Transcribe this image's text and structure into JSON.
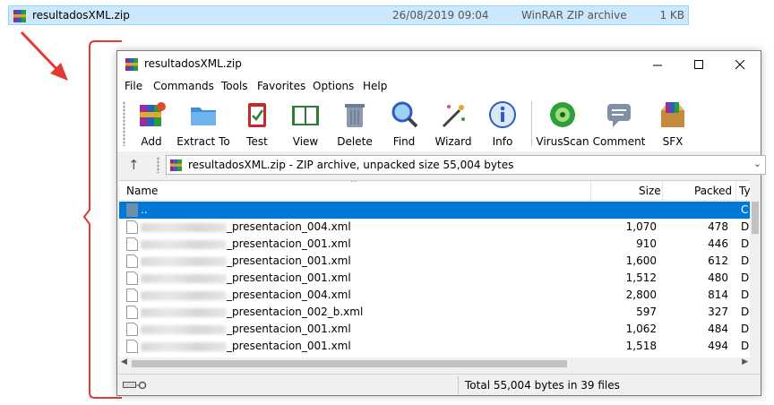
{
  "explorer": {
    "file_name": "resultadosXML.zip",
    "date": "26/08/2019 09:04",
    "type": "WinRAR ZIP archive",
    "size": "1 KB"
  },
  "annotation": {
    "color": "#e53935"
  },
  "window": {
    "title": "resultadosXML.zip",
    "menu": [
      "File",
      "Commands",
      "Tools",
      "Favorites",
      "Options",
      "Help"
    ],
    "toolbar": [
      {
        "label": "Add",
        "icon": "add-books-icon"
      },
      {
        "label": "Extract To",
        "icon": "extract-folder-icon"
      },
      {
        "label": "Test",
        "icon": "test-clipboard-icon"
      },
      {
        "label": "View",
        "icon": "view-book-icon"
      },
      {
        "label": "Delete",
        "icon": "trash-icon"
      },
      {
        "label": "Find",
        "icon": "magnifier-icon"
      },
      {
        "label": "Wizard",
        "icon": "wand-icon"
      },
      {
        "label": "Info",
        "icon": "info-icon"
      },
      {
        "label": "VirusScan",
        "icon": "virus-scan-icon"
      },
      {
        "label": "Comment",
        "icon": "comment-icon"
      },
      {
        "label": "SFX",
        "icon": "sfx-box-icon"
      }
    ],
    "address": "resultadosXML.zip - ZIP archive, unpacked size 55,004 bytes",
    "columns": {
      "name": "Name",
      "size": "Size",
      "packed": "Packed",
      "type": "Ty"
    },
    "parent_row": {
      "name": "..",
      "type": "C"
    },
    "files": [
      {
        "name": "_presentacion_004.xml",
        "size": "1,070",
        "packed": "478",
        "type": "D"
      },
      {
        "name": "_presentacion_001.xml",
        "size": "910",
        "packed": "446",
        "type": "D"
      },
      {
        "name": "_presentacion_001.xml",
        "size": "1,600",
        "packed": "612",
        "type": "D"
      },
      {
        "name": "_presentacion_001.xml",
        "size": "1,512",
        "packed": "480",
        "type": "D"
      },
      {
        "name": "_presentacion_004.xml",
        "size": "2,800",
        "packed": "814",
        "type": "D"
      },
      {
        "name": "_presentacion_002_b.xml",
        "size": "597",
        "packed": "327",
        "type": "D"
      },
      {
        "name": "_presentacion_001.xml",
        "size": "1,062",
        "packed": "484",
        "type": "D"
      },
      {
        "name": "_presentacion_001.xml",
        "size": "1,518",
        "packed": "494",
        "type": "D"
      }
    ],
    "status": "Total 55,004 bytes in 39 files"
  }
}
